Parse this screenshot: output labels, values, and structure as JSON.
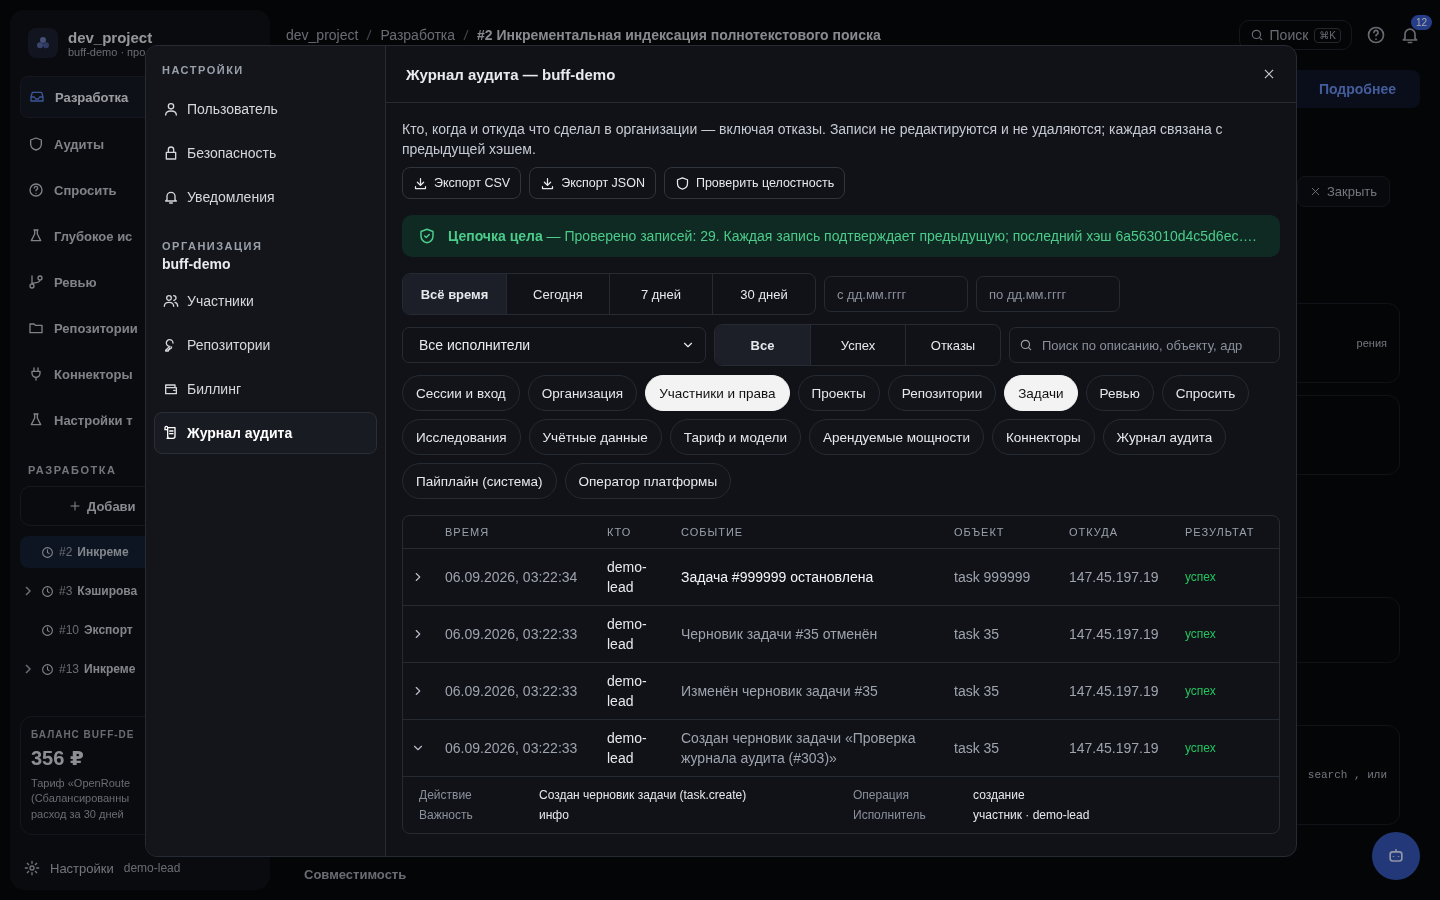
{
  "background": {
    "project": {
      "name": "dev_project",
      "sub": "buff-demo · про"
    },
    "nav": [
      {
        "label": "Разработка",
        "selected": true
      },
      {
        "label": "Аудиты",
        "selected": false
      },
      {
        "label": "Спросить",
        "selected": false
      },
      {
        "label": "Глубокое ис",
        "selected": false
      },
      {
        "label": "Ревью",
        "selected": false
      },
      {
        "label": "Репозитории",
        "selected": false
      },
      {
        "label": "Коннекторы",
        "selected": false
      },
      {
        "label": "Настройки т",
        "selected": false
      }
    ],
    "section_label": "РАЗРАБОТКА",
    "add_button": "Добави",
    "tasks": [
      {
        "number": "#2",
        "title": "Инкреме",
        "expandable": false,
        "selected": true
      },
      {
        "number": "#3",
        "title": "Кэширова",
        "expandable": true,
        "selected": false
      },
      {
        "number": "#10",
        "title": "Экспорт",
        "expandable": false,
        "selected": false
      },
      {
        "number": "#13",
        "title": "Инкреме",
        "expandable": true,
        "selected": false
      }
    ],
    "balance": {
      "label": "БАЛАНС BUFF-DE",
      "amount": "356 ₽",
      "lines": [
        "Тариф «OpenRoute",
        "(Сбалансированны",
        "расход за 30 дней"
      ]
    },
    "footer": {
      "settings": "Настройки",
      "user": "demo-lead"
    },
    "breadcrumbs": [
      "dev_project",
      "Разработка",
      "#2 Инкрементальная индексация полнотекстового поиска"
    ],
    "search": {
      "placeholder": "Поиск",
      "shortcut": "⌘K"
    },
    "notifications_badge": "12",
    "banner_link": "Подробнее",
    "close_button": "Закрыть",
    "card_fragments": [
      "рения",
      "search , или"
    ],
    "bottom_tab": "Совместимость"
  },
  "modal": {
    "nav": {
      "heading": "НАСТРОЙКИ",
      "items": [
        {
          "label": "Пользователь",
          "selected": false
        },
        {
          "label": "Безопасность",
          "selected": false
        },
        {
          "label": "Уведомления",
          "selected": false
        }
      ],
      "org_heading": "ОРГАНИЗАЦИЯ",
      "org_name": "buff-demo",
      "org_items": [
        {
          "label": "Участники",
          "selected": false
        },
        {
          "label": "Репозитории",
          "selected": false
        },
        {
          "label": "Биллинг",
          "selected": false
        },
        {
          "label": "Журнал аудита",
          "selected": true
        }
      ]
    },
    "title": "Журнал аудита — buff-demo",
    "description": "Кто, когда и откуда что сделал в организации — включая отказы. Записи не редактируются и не удаляются; каждая связана с предыдущей хэшем.",
    "actions": [
      "Экспорт CSV",
      "Экспорт JSON",
      "Проверить целостность"
    ],
    "integrity": {
      "ok": true,
      "message": "**Цепочка цела** — Проверено записей: 29. Каждая запись подтверждает предыдущую; последний хэш 6a563010d4c5d6ec…."
    },
    "periods": [
      {
        "label": "Всё время",
        "selected": true
      },
      {
        "label": "Сегодня",
        "selected": false
      },
      {
        "label": "7 дней",
        "selected": false
      },
      {
        "label": "30 дней",
        "selected": false
      }
    ],
    "date_from": {
      "placeholder": "с дд.мм.гггг"
    },
    "date_to": {
      "placeholder": "по дд.мм.гггг"
    },
    "actor_filter": "Все исполнители",
    "results": [
      {
        "label": "Все",
        "selected": true
      },
      {
        "label": "Успех",
        "selected": false
      },
      {
        "label": "Отказы",
        "selected": false
      }
    ],
    "search": {
      "placeholder": "Поиск по описанию, объекту, адр"
    },
    "categories": [
      {
        "label": "Сессии и вход",
        "selected": false
      },
      {
        "label": "Организация",
        "selected": false
      },
      {
        "label": "Участники и права",
        "selected": true
      },
      {
        "label": "Проекты",
        "selected": false
      },
      {
        "label": "Репозитории",
        "selected": false
      },
      {
        "label": "Задачи",
        "selected": true
      },
      {
        "label": "Ревью",
        "selected": false
      },
      {
        "label": "Спросить",
        "selected": false
      },
      {
        "label": "Исследования",
        "selected": false
      },
      {
        "label": "Учётные данные",
        "selected": false
      },
      {
        "label": "Тариф и модели",
        "selected": false
      },
      {
        "label": "Арендуемые мощности",
        "selected": false
      },
      {
        "label": "Коннекторы",
        "selected": false
      },
      {
        "label": "Журнал аудита",
        "selected": false
      },
      {
        "label": "Пайплайн (система)",
        "selected": false
      },
      {
        "label": "Оператор платформы",
        "selected": false
      }
    ],
    "table": {
      "columns": [
        "ВРЕМЯ",
        "КТО",
        "СОБЫТИЕ",
        "ОБЪЕКТ",
        "ОТКУДА",
        "РЕЗУЛЬТАТ"
      ],
      "rows": [
        {
          "time": "06.09.2026, 03:22:34",
          "who": "demo-lead",
          "event": "Задача #999999 остановлена",
          "emphasized": true,
          "object": "task 999999",
          "from": "147.45.197.19",
          "result": "успех",
          "expanded": false
        },
        {
          "time": "06.09.2026, 03:22:33",
          "who": "demo-lead",
          "event": "Черновик задачи #35 отменён",
          "emphasized": false,
          "object": "task 35",
          "from": "147.45.197.19",
          "result": "успех",
          "expanded": false
        },
        {
          "time": "06.09.2026, 03:22:33",
          "who": "demo-lead",
          "event": "Изменён черновик задачи #35",
          "emphasized": false,
          "object": "task 35",
          "from": "147.45.197.19",
          "result": "успех",
          "expanded": false
        },
        {
          "time": "06.09.2026, 03:22:33",
          "who": "demo-lead",
          "event": "Создан черновик задачи «Проверка журнала аудита (#303)»",
          "emphasized": false,
          "object": "task 35",
          "from": "147.45.197.19",
          "result": "успех",
          "expanded": true,
          "details": [
            {
              "label": "Действие",
              "value": "Создан черновик задачи (task.create)"
            },
            {
              "label": "Операция",
              "value": "создание"
            },
            {
              "label": "Важность",
              "value": "инфо"
            },
            {
              "label": "Исполнитель",
              "value": "участник · demo-lead"
            }
          ]
        }
      ]
    }
  }
}
